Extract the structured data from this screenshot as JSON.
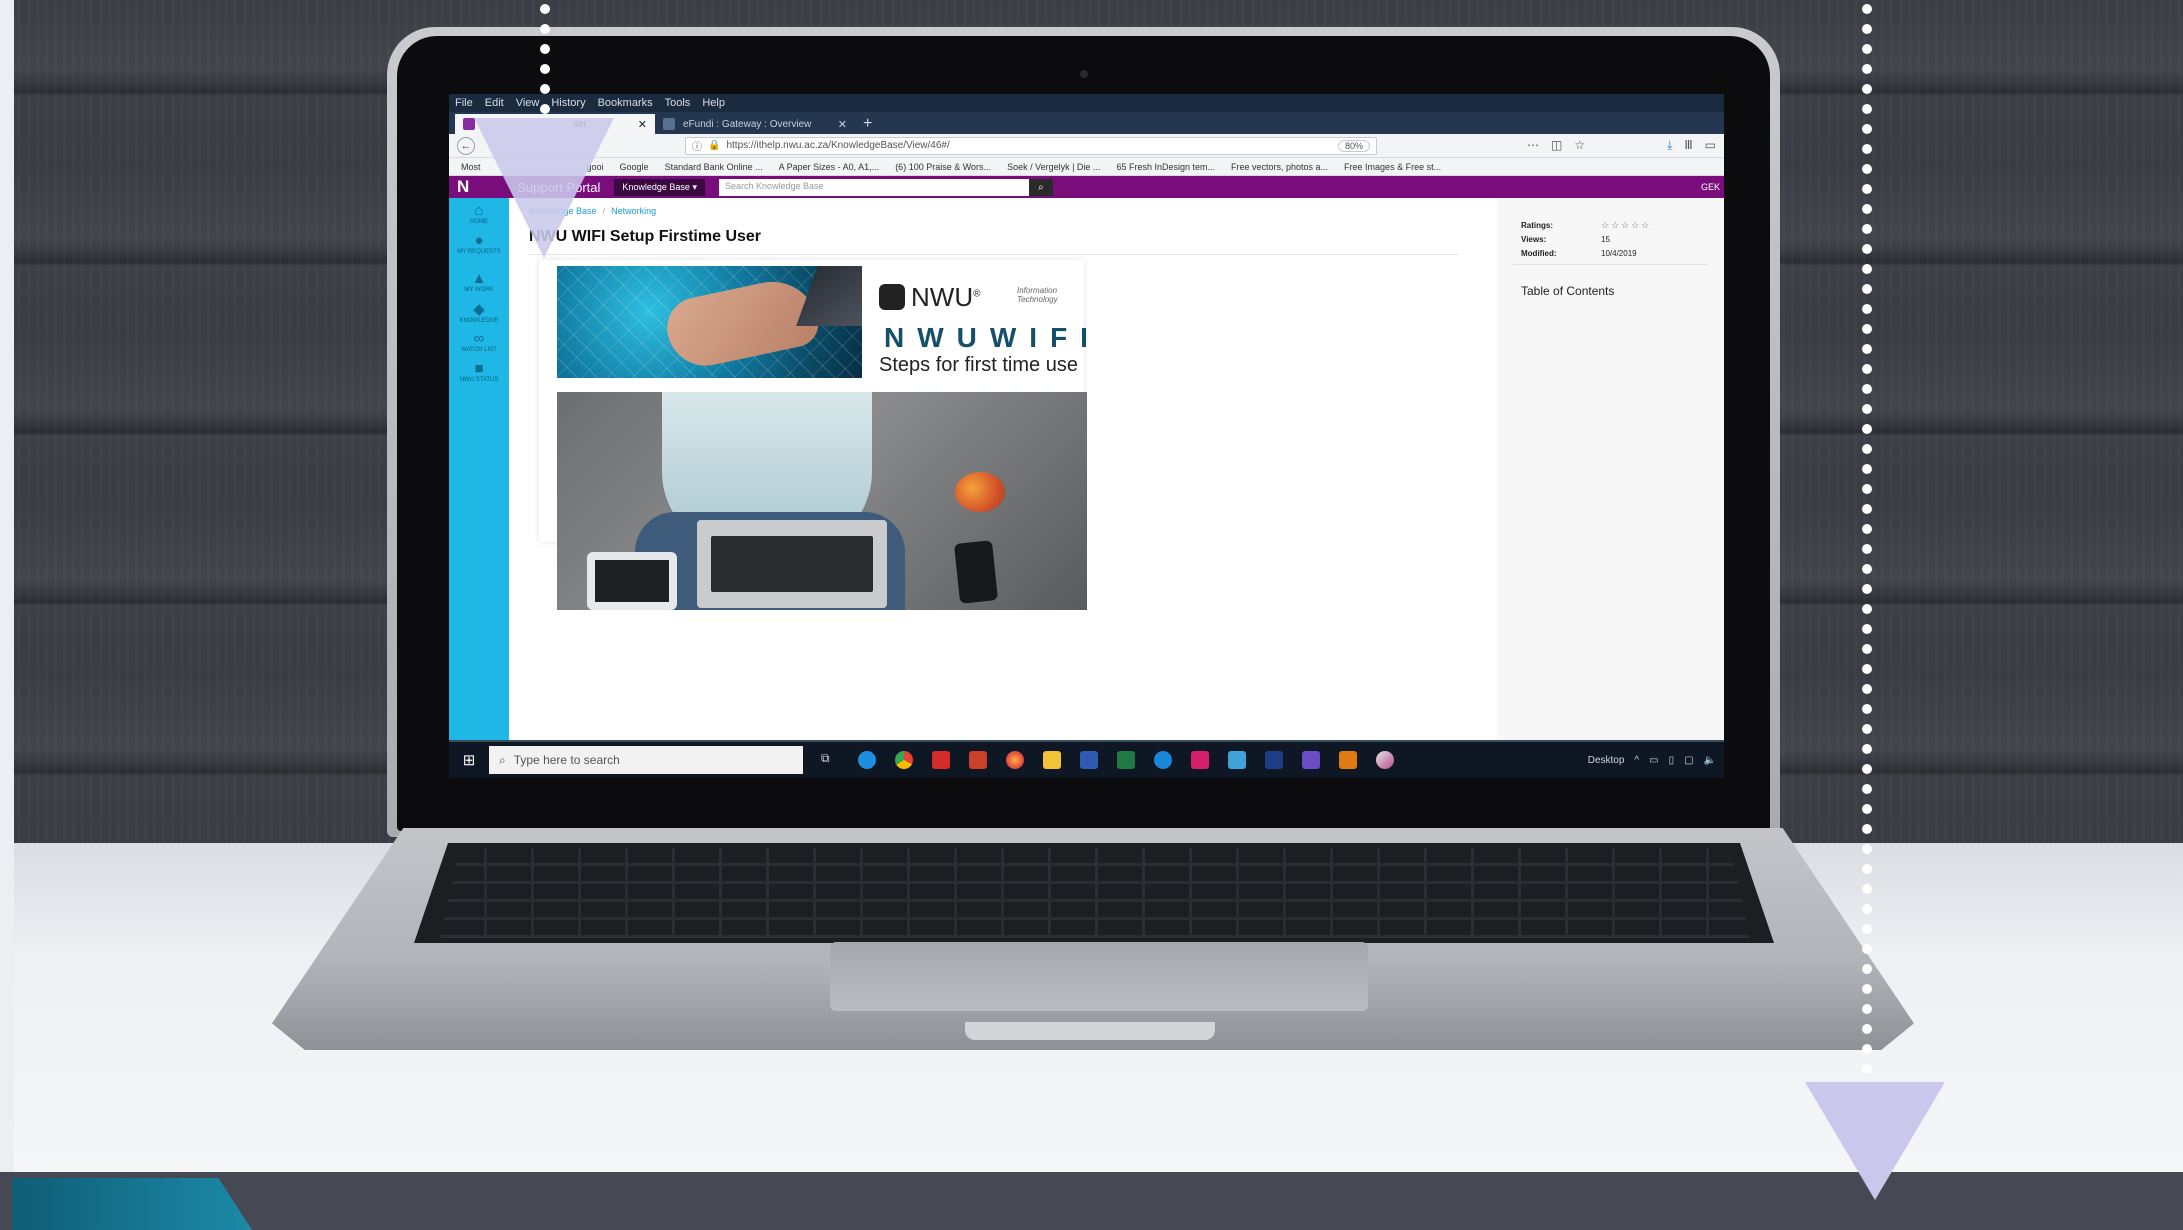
{
  "browser": {
    "menu": [
      "File",
      "Edit",
      "View",
      "History",
      "Bookmarks",
      "Tools",
      "Help"
    ],
    "tabs": [
      {
        "label": "ser",
        "active": true
      },
      {
        "label": "eFundi : Gateway : Overview",
        "active": false
      }
    ],
    "url": "https://ithelp.nwu.ac.za/KnowledgeBase/View/46#/",
    "zoom": "80%",
    "bookmarks": [
      "Most",
      "gooi",
      "Google",
      "Standard Bank Online ...",
      "A Paper Sizes - A0, A1,...",
      "(6) 100 Praise & Wors...",
      "Soek / Vergelyk | Die ...",
      "65 Fresh InDesign tem...",
      "Free vectors, photos a...",
      "Free Images & Free st..."
    ]
  },
  "portal": {
    "logo": "N",
    "title": "Support Portal",
    "kb_dropdown": "Knowledge Base ▾",
    "search_placeholder": "Search Knowledge Base",
    "user": "GEK"
  },
  "sidebar": {
    "items": [
      {
        "label": "HOME",
        "icon": "home-icon"
      },
      {
        "label": "MY REQUESTS",
        "icon": "chat-icon"
      },
      {
        "label": "MY WORK",
        "icon": "person-icon"
      },
      {
        "label": "KNOWLEDGE",
        "icon": "knowledge-icon"
      },
      {
        "label": "WATCH LIST",
        "icon": "binoculars-icon"
      },
      {
        "label": "NWU STATUS",
        "icon": "status-icon"
      }
    ]
  },
  "article": {
    "breadcrumb": [
      "Knowledge Base",
      "Networking"
    ],
    "title": "NWU WIFI Setup Firstime User",
    "banner": {
      "logo_text": "NWU",
      "logo_mark": "®",
      "dept": "Information Technology",
      "headline": "NWUWIFI",
      "subtitle": "Steps for first time use"
    }
  },
  "meta": {
    "ratings_label": "Ratings:",
    "ratings_value": "☆☆☆☆☆",
    "views_label": "Views:",
    "views_value": "15",
    "modified_label": "Modified:",
    "modified_value": "10/4/2019",
    "toc_label": "Table of Contents"
  },
  "taskbar": {
    "search_placeholder": "Type here to search",
    "desktop_label": "Desktop"
  },
  "colors": {
    "portal_bar": "#7a0d7c",
    "side_rail": "#1eb7e6",
    "overlay_arrow": "#c9c8ec"
  }
}
